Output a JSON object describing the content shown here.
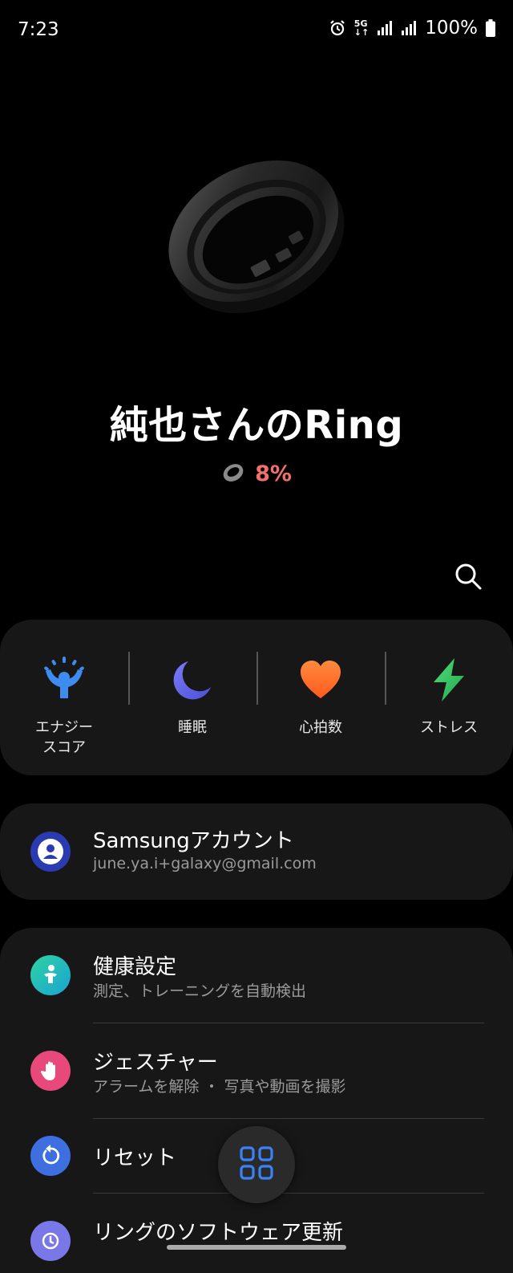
{
  "status_bar": {
    "time": "7:23",
    "network": "5G",
    "battery": "100%",
    "icons": [
      "alarm-icon",
      "network-5g-icon",
      "signal-icon",
      "signal-icon",
      "battery-icon"
    ]
  },
  "device": {
    "name": "純也さんのRing",
    "battery": "8%",
    "battery_color": "#f2706a"
  },
  "health_tiles": [
    {
      "label": "エナジー\nスコア",
      "icon": "energy-score-icon",
      "color": "#3f8cf0"
    },
    {
      "label": "睡眠",
      "icon": "sleep-moon-icon",
      "color": "#6b6cf0"
    },
    {
      "label": "心拍数",
      "icon": "heart-icon",
      "color": "#ff6b33"
    },
    {
      "label": "ストレス",
      "icon": "stress-bolt-icon",
      "color": "#38c96a"
    }
  ],
  "account": {
    "title": "Samsungアカウント",
    "email": "june.ya.i+galaxy@gmail.com",
    "icon": "account-icon"
  },
  "settings": [
    {
      "title": "健康設定",
      "subtitle": "測定、トレーニングを自動検出",
      "icon": "health-settings-icon"
    },
    {
      "title": "ジェスチャー",
      "subtitle": "アラームを解除 ・ 写真や動画を撮影",
      "icon": "gesture-hand-icon"
    },
    {
      "title": "リセット",
      "subtitle": "",
      "icon": "reset-icon"
    },
    {
      "title": "リングのソフトウェア更新",
      "subtitle": "",
      "icon": "software-update-icon"
    }
  ],
  "fab": {
    "icon": "apps-grid-icon",
    "color": "#3b82f6"
  }
}
